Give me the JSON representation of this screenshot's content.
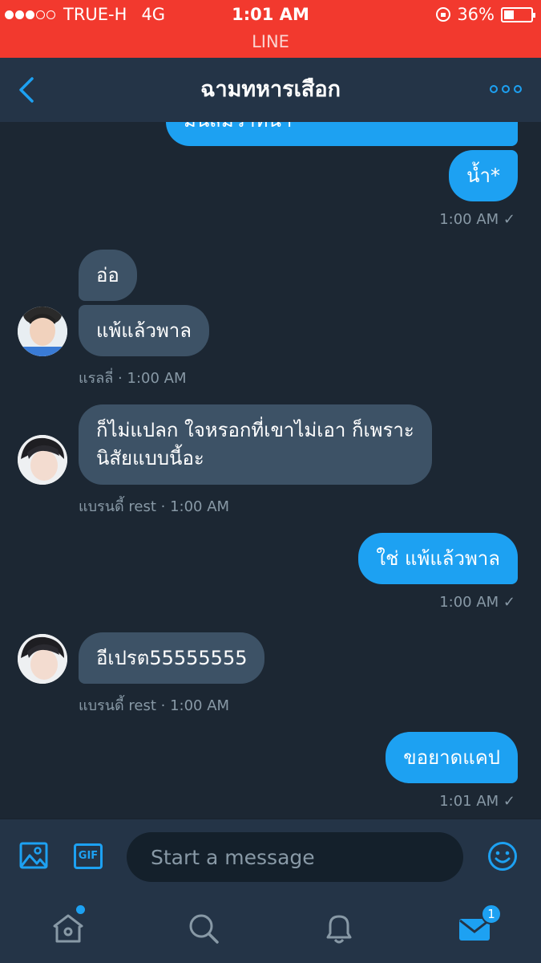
{
  "status_bar": {
    "carrier": "TRUE-H",
    "network": "4G",
    "time": "1:01 AM",
    "battery": "36%",
    "battery_level": 0.36,
    "app_label": "LINE"
  },
  "header": {
    "title": "ฉามทหารเสือก"
  },
  "messages": [
    {
      "text": "มนสมวาทนา",
      "meta": ""
    },
    {
      "text": "น้ำ*",
      "meta": "1:00 AM ✓"
    },
    {
      "text": "อ่อ",
      "meta": ""
    },
    {
      "text": "แพ้แล้วพาล",
      "meta": "แรลลี่ · 1:00 AM"
    },
    {
      "text_line1": "ก็ไม่แปลก ใจหรอกที่เขาไม่เอา ก็เพราะ",
      "text_line2": "นิสัยแบบนี้อะ",
      "meta": "แบรนดี้ rest · 1:00 AM"
    },
    {
      "text": "ใช่ แพ้แล้วพาล",
      "meta": "1:00 AM ✓"
    },
    {
      "text": "อีเปรต55555555",
      "meta": "แบรนดี้ rest · 1:00 AM"
    },
    {
      "text": "ขอยาดแคป",
      "meta": "1:01 AM ✓"
    }
  ],
  "composer": {
    "placeholder": "Start a message",
    "gif_label": "GIF"
  },
  "tabbar": {
    "messages_badge": "1"
  },
  "icons": {
    "back": "chevron-left-icon",
    "more": "more-icon",
    "image": "image-icon",
    "gif": "gif-icon",
    "emoji": "emoji-icon",
    "home": "home-icon",
    "search": "search-icon",
    "notifications": "bell-icon",
    "messages": "envelope-icon"
  },
  "colors": {
    "status_bar": "#f2392e",
    "background": "#1c2733",
    "header": "#243447",
    "outgoing_bubble": "#1da1f2",
    "incoming_bubble": "#3d5266",
    "accent": "#1da1f2"
  }
}
